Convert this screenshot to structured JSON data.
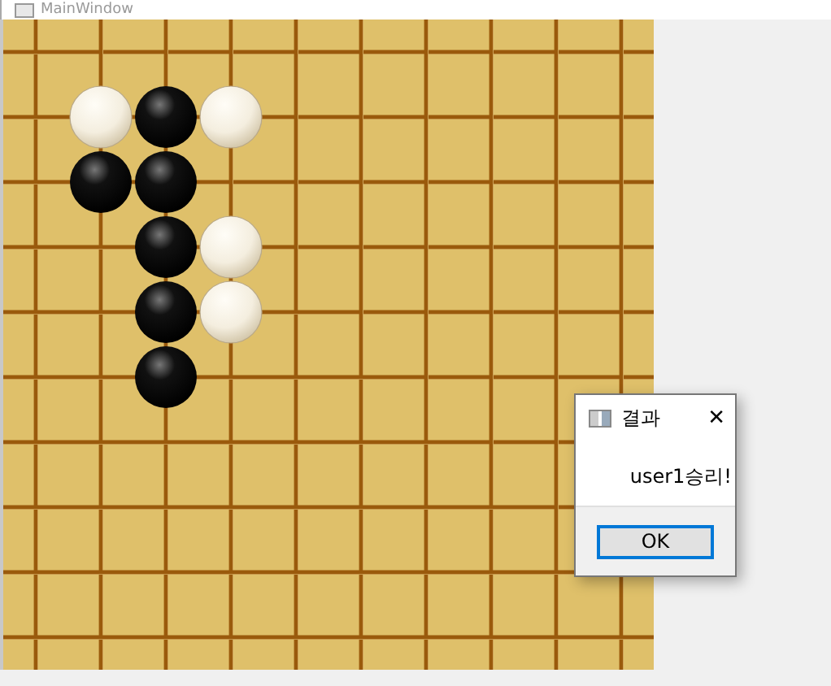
{
  "window": {
    "title": "MainWindow"
  },
  "board": {
    "rows": [
      {
        "cells": [
          {
            "kind": "empty"
          }
        ]
      },
      {
        "cells": [
          {
            "kind": "empty"
          },
          {
            "kind": "white"
          },
          {
            "kind": "black"
          },
          {
            "kind": "white"
          }
        ]
      },
      {
        "cells": [
          {
            "kind": "empty"
          },
          {
            "kind": "black"
          },
          {
            "kind": "black"
          }
        ]
      },
      {
        "cells": [
          {
            "kind": "empty"
          },
          {
            "kind": "empty"
          },
          {
            "kind": "black"
          },
          {
            "kind": "white"
          }
        ]
      },
      {
        "cells": [
          {
            "kind": "empty"
          },
          {
            "kind": "empty"
          },
          {
            "kind": "black"
          },
          {
            "kind": "white"
          }
        ]
      },
      {
        "cells": [
          {
            "kind": "empty"
          },
          {
            "kind": "empty"
          },
          {
            "kind": "black"
          }
        ]
      }
    ]
  },
  "dialog": {
    "title": "결과",
    "close": "✕",
    "message": "user1승리!",
    "buttons": [
      "OK"
    ]
  }
}
